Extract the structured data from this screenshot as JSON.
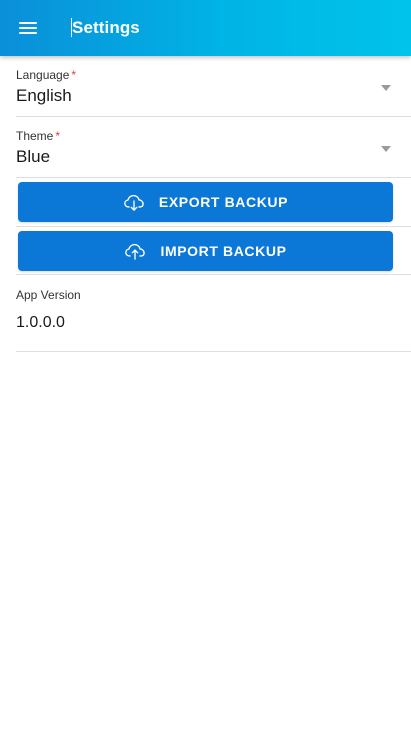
{
  "header": {
    "title": "Settings",
    "menu_icon": "hamburger-menu-icon"
  },
  "form": {
    "language": {
      "label": "Language",
      "required_mark": "*",
      "value": "English"
    },
    "theme": {
      "label": "Theme",
      "required_mark": "*",
      "value": "Blue"
    },
    "export_button": {
      "label": "EXPORT BACKUP",
      "icon": "cloud-download-icon"
    },
    "import_button": {
      "label": "IMPORT BACKUP",
      "icon": "cloud-upload-icon"
    },
    "version": {
      "label": "App Version",
      "value": "1.0.0.0"
    }
  },
  "colors": {
    "header_start": "#0a8fd8",
    "header_end": "#00c3ea",
    "button": "#0b78d8",
    "required": "#e53935"
  }
}
